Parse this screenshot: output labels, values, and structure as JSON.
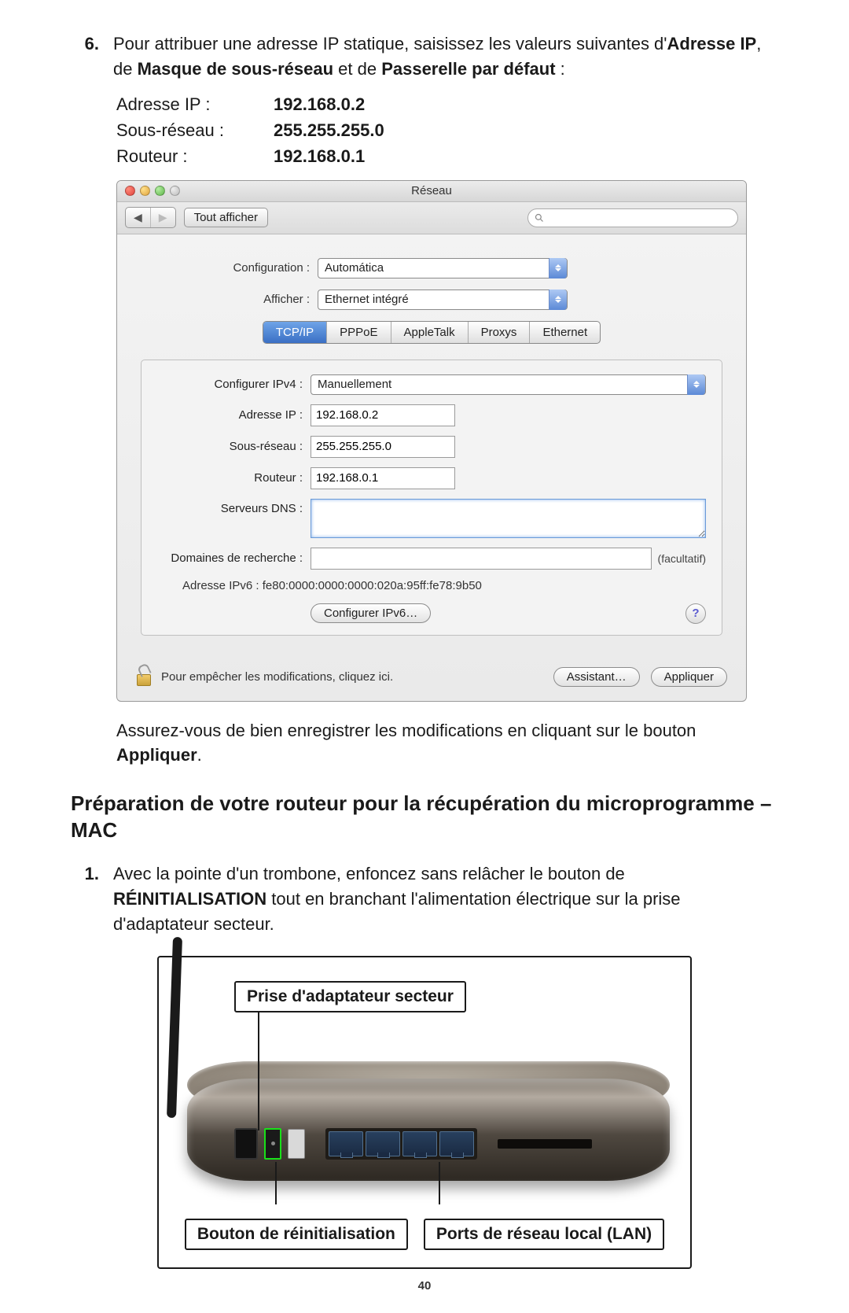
{
  "step6": {
    "num": "6.",
    "text_a": "Pour attribuer une adresse IP statique, saisissez les valeurs suivantes d'",
    "bold1": "Adresse IP",
    "text_b": ", de ",
    "bold2": "Masque de sous-réseau",
    "text_c": " et de ",
    "bold3": "Passerelle par défaut",
    "text_d": " :"
  },
  "ip_table": {
    "rows": [
      {
        "label": "Adresse IP :",
        "value": "192.168.0.2"
      },
      {
        "label": "Sous-réseau :",
        "value": "255.255.255.0"
      },
      {
        "label": "Routeur :",
        "value": "192.168.0.1"
      }
    ]
  },
  "macwin": {
    "title": "Réseau",
    "show_all": "Tout afficher",
    "config_label": "Configuration :",
    "config_value": "Automática",
    "show_label": "Afficher :",
    "show_value": "Ethernet intégré",
    "tabs": [
      "TCP/IP",
      "PPPoE",
      "AppleTalk",
      "Proxys",
      "Ethernet"
    ],
    "ipv4_label": "Configurer IPv4 :",
    "ipv4_value": "Manuellement",
    "ip_label": "Adresse IP :",
    "ip_value": "192.168.0.2",
    "subnet_label": "Sous-réseau :",
    "subnet_value": "255.255.255.0",
    "router_label": "Routeur :",
    "router_value": "192.168.0.1",
    "dns_label": "Serveurs DNS :",
    "search_label": "Domaines de recherche :",
    "facultatif": "(facultatif)",
    "ipv6_label": "Adresse IPv6 :",
    "ipv6_value": "fe80:0000:0000:0000:020a:95ff:fe78:9b50",
    "config_ipv6_btn": "Configurer IPv6…",
    "lock_text": "Pour empêcher les modifications, cliquez ici.",
    "assistant_btn": "Assistant…",
    "apply_btn": "Appliquer",
    "help": "?"
  },
  "after_text": {
    "a": "Assurez-vous de bien enregistrer les modifications en cliquant sur le bouton ",
    "bold": "Appliquer",
    "b": "."
  },
  "section_title": "Préparation de votre routeur pour la récupération du microprogramme – MAC",
  "step1": {
    "num": "1.",
    "a": "Avec la pointe d'un trombone, enfoncez sans relâcher le bouton de ",
    "bold": "RÉINITIALISATION",
    "b": " tout en branchant l'alimentation électrique sur la prise d'adaptateur secteur."
  },
  "router_labels": {
    "top": "Prise d'adaptateur secteur",
    "bottom_left": "Bouton de réinitialisation",
    "bottom_right": "Ports de réseau local (LAN)"
  },
  "page_number": "40"
}
